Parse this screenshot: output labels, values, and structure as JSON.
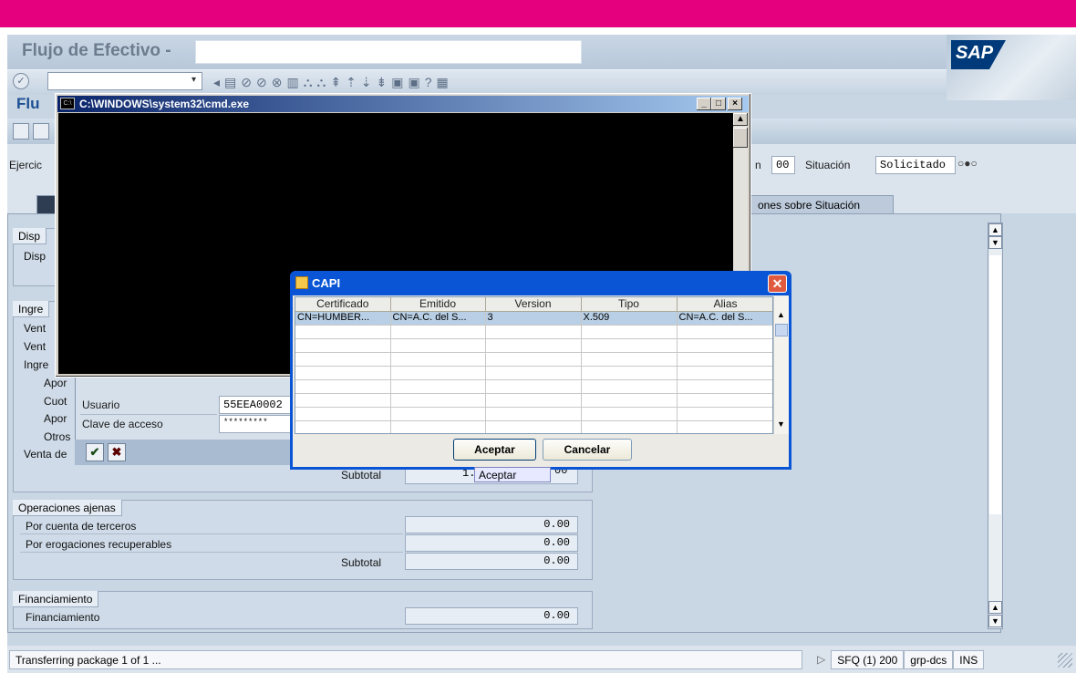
{
  "window": {
    "title": "Flujo de Efectivo -",
    "screen_title": "Flu",
    "brand": "SAP"
  },
  "colors": {
    "accent": "#e5007d",
    "sap_blue": "#1c4f93",
    "xp_title": "#0a55d6"
  },
  "toolbar": {
    "icons": [
      "enter-icon",
      "dropdown-icon",
      "back-icon",
      "save-icon",
      "nav-back-icon",
      "nav-exit-icon",
      "nav-cancel-icon",
      "print-icon",
      "find-icon",
      "find-next-icon",
      "first-page-icon",
      "prev-page-icon",
      "next-page-icon",
      "last-page-icon",
      "new-session-icon",
      "shortcut-icon",
      "help-icon",
      "layout-icon"
    ],
    "glyphs": [
      "✓",
      "▾",
      "◂",
      "▤",
      "⊘",
      "⊘",
      "⊗",
      "▥",
      "⛬",
      "⛬",
      "⇞",
      "⇡",
      "⇣",
      "⇟",
      "▣",
      "▣",
      "?",
      "▦"
    ]
  },
  "header": {
    "ejercicio_label": "Ejercic",
    "n_label": "n",
    "n_value": "00",
    "situacion_label": "Situación",
    "situacion_value": "Solicitado"
  },
  "tabs": [
    {
      "label": ""
    },
    {
      "label": "ones sobre Situación"
    }
  ],
  "groups": {
    "disp": {
      "title": "Disp",
      "rows": [
        "Disp"
      ]
    },
    "ingre": {
      "title": "Ingre",
      "rows": [
        "Vent",
        "Vent",
        "Ingre",
        "Apor",
        "Cuot",
        "Apor",
        "Otros",
        "Venta de"
      ]
    },
    "ingre_subtotal": {
      "label": "Subtotal",
      "value": "1."
    },
    "operaciones": {
      "title": "Operaciones ajenas",
      "rows": [
        {
          "label": "Por cuenta de terceros",
          "value": "0.00"
        },
        {
          "label": "Por erogaciones recuperables",
          "value": "0.00"
        }
      ],
      "subtotal_label": "Subtotal",
      "subtotal_value": "0.00"
    },
    "financiamiento": {
      "title": "Financiamiento",
      "rows": [
        {
          "label": "Financiamiento",
          "value": "0.00"
        }
      ]
    }
  },
  "logon": {
    "usuario_label": "Usuario",
    "usuario_value": "55EEA0002",
    "clave_label": "Clave de acceso",
    "clave_value": "*********"
  },
  "cmd": {
    "title": "C:\\WINDOWS\\system32\\cmd.exe",
    "icon_text": "C:\\"
  },
  "capi": {
    "title": "CAPI",
    "columns": [
      "Certificado",
      "Emitido",
      "Version",
      "Tipo",
      "Alias"
    ],
    "rows": [
      [
        "CN=HUMBER...",
        "CN=A.C. del S...",
        "3",
        "X.509",
        "CN=A.C. del S..."
      ]
    ],
    "ok_label": "Aceptar",
    "cancel_label": "Cancelar",
    "tooltip": "Aceptar"
  },
  "tail_value": "00",
  "status": {
    "message": "Transferring package 1  of 1  ...",
    "system": "SFQ (1) 200",
    "server": "grp-dcs",
    "mode": "INS"
  }
}
